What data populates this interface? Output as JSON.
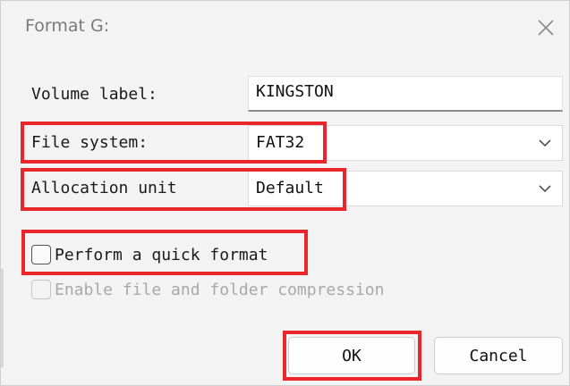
{
  "dialog": {
    "title": "Format G:"
  },
  "fields": {
    "volume_label": {
      "label": "Volume label:",
      "value": "KINGSTON"
    },
    "file_system": {
      "label": "File system:",
      "value": "FAT32"
    },
    "allocation_unit": {
      "label": "Allocation unit",
      "value": "Default"
    }
  },
  "options": {
    "quick_format": {
      "label": "Perform a quick format",
      "checked": false
    },
    "compression": {
      "label": "Enable file and folder compression",
      "checked": false,
      "enabled": false
    }
  },
  "buttons": {
    "ok": "OK",
    "cancel": "Cancel"
  },
  "icons": {
    "close": "close-icon",
    "dropdown": "chevron-down-icon"
  },
  "colors": {
    "highlight": "#e8262b",
    "dialog_bg": "#f3f3f3"
  }
}
